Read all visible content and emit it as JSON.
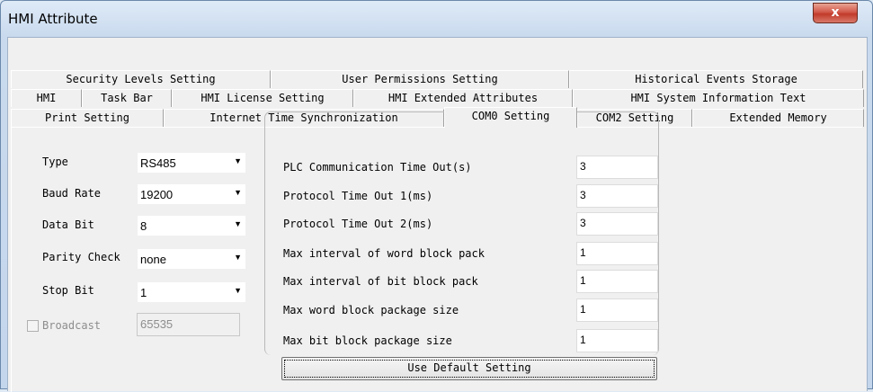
{
  "window": {
    "title": "HMI Attribute",
    "close_label": "x"
  },
  "tabs": {
    "row1": [
      "Security Levels Setting",
      "User Permissions Setting",
      "Historical Events Storage"
    ],
    "row2": [
      "HMI",
      "Task Bar",
      "HMI License Setting",
      "HMI Extended Attributes",
      "HMI System Information Text"
    ],
    "row3": [
      "Print Setting",
      "Internet Time Synchronization",
      "COM0 Setting",
      "COM2 Setting",
      "Extended Memory"
    ],
    "active": "COM0 Setting"
  },
  "serial": {
    "type_label": "Type",
    "type_value": "RS485",
    "baud_label": "Baud Rate",
    "baud_value": "19200",
    "databit_label": "Data Bit",
    "databit_value": "8",
    "parity_label": "Parity Check",
    "parity_value": "none",
    "stopbit_label": "Stop Bit",
    "stopbit_value": "1",
    "broadcast_label": "Broadcast",
    "broadcast_value": "65535"
  },
  "timeouts": {
    "rows": [
      {
        "label": "PLC Communication Time Out(s)",
        "value": "3"
      },
      {
        "label": "Protocol Time Out 1(ms)",
        "value": "3"
      },
      {
        "label": "Protocol Time Out 2(ms)",
        "value": "3"
      },
      {
        "label": "Max interval of word block pack",
        "value": "1"
      },
      {
        "label": "Max interval of bit block pack",
        "value": "1"
      },
      {
        "label": "Max word block package size",
        "value": "1"
      },
      {
        "label": "Max bit block package size",
        "value": "1"
      }
    ],
    "default_button": "Use Default Setting"
  }
}
